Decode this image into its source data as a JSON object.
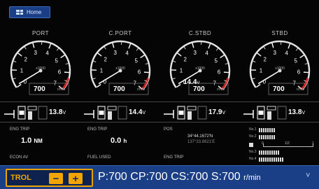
{
  "home": {
    "label": "Home"
  },
  "gauges": [
    {
      "name": "PORT",
      "rpm": "700",
      "unit": "r/min",
      "volt": ""
    },
    {
      "name": "C.PORT",
      "rpm": "700",
      "unit": "r/min",
      "volt": ""
    },
    {
      "name": "C.STBD",
      "rpm": "700",
      "unit": "r/min",
      "volt": "14.4"
    },
    {
      "name": "STBD",
      "rpm": "700",
      "unit": "r/min",
      "volt": ""
    }
  ],
  "gauge_scale": {
    "multiplier": "x1000",
    "ticks": [
      "0",
      "1",
      "2",
      "3",
      "4",
      "5",
      "6",
      "7"
    ]
  },
  "shift": [
    {
      "volt": "13.8",
      "unit": "V"
    },
    {
      "volt": "14.4",
      "unit": "V"
    },
    {
      "volt": "17.9",
      "unit": "V"
    },
    {
      "volt": "13.8",
      "unit": "V"
    }
  ],
  "info": {
    "eng_trip_1": {
      "label": "ENG TRIP",
      "value": "1.0",
      "unit": "NM"
    },
    "eng_trip_2": {
      "label": "ENG TRIP",
      "value": "0.0",
      "unit": "h"
    },
    "pos": {
      "label": "POS",
      "lat": "34°44.1672'N",
      "lon": "137°33.8821'E"
    },
    "econ_av": {
      "label": "ECON AV"
    },
    "fuel_used": {
      "label": "FUEL USED"
    },
    "eng_trip_3": {
      "label": "ENG TRIP"
    }
  },
  "bars": {
    "tags": [
      "No.1",
      "No.2",
      "No.3",
      "No.4"
    ],
    "scale": [
      "0",
      "1/2",
      "1"
    ]
  },
  "bottom": {
    "mode": "TROL",
    "minus": "−",
    "plus": "+",
    "summary": "P:700  CP:700  CS:700  S:700",
    "summary_unit": "r/min",
    "chevron": "˅"
  }
}
